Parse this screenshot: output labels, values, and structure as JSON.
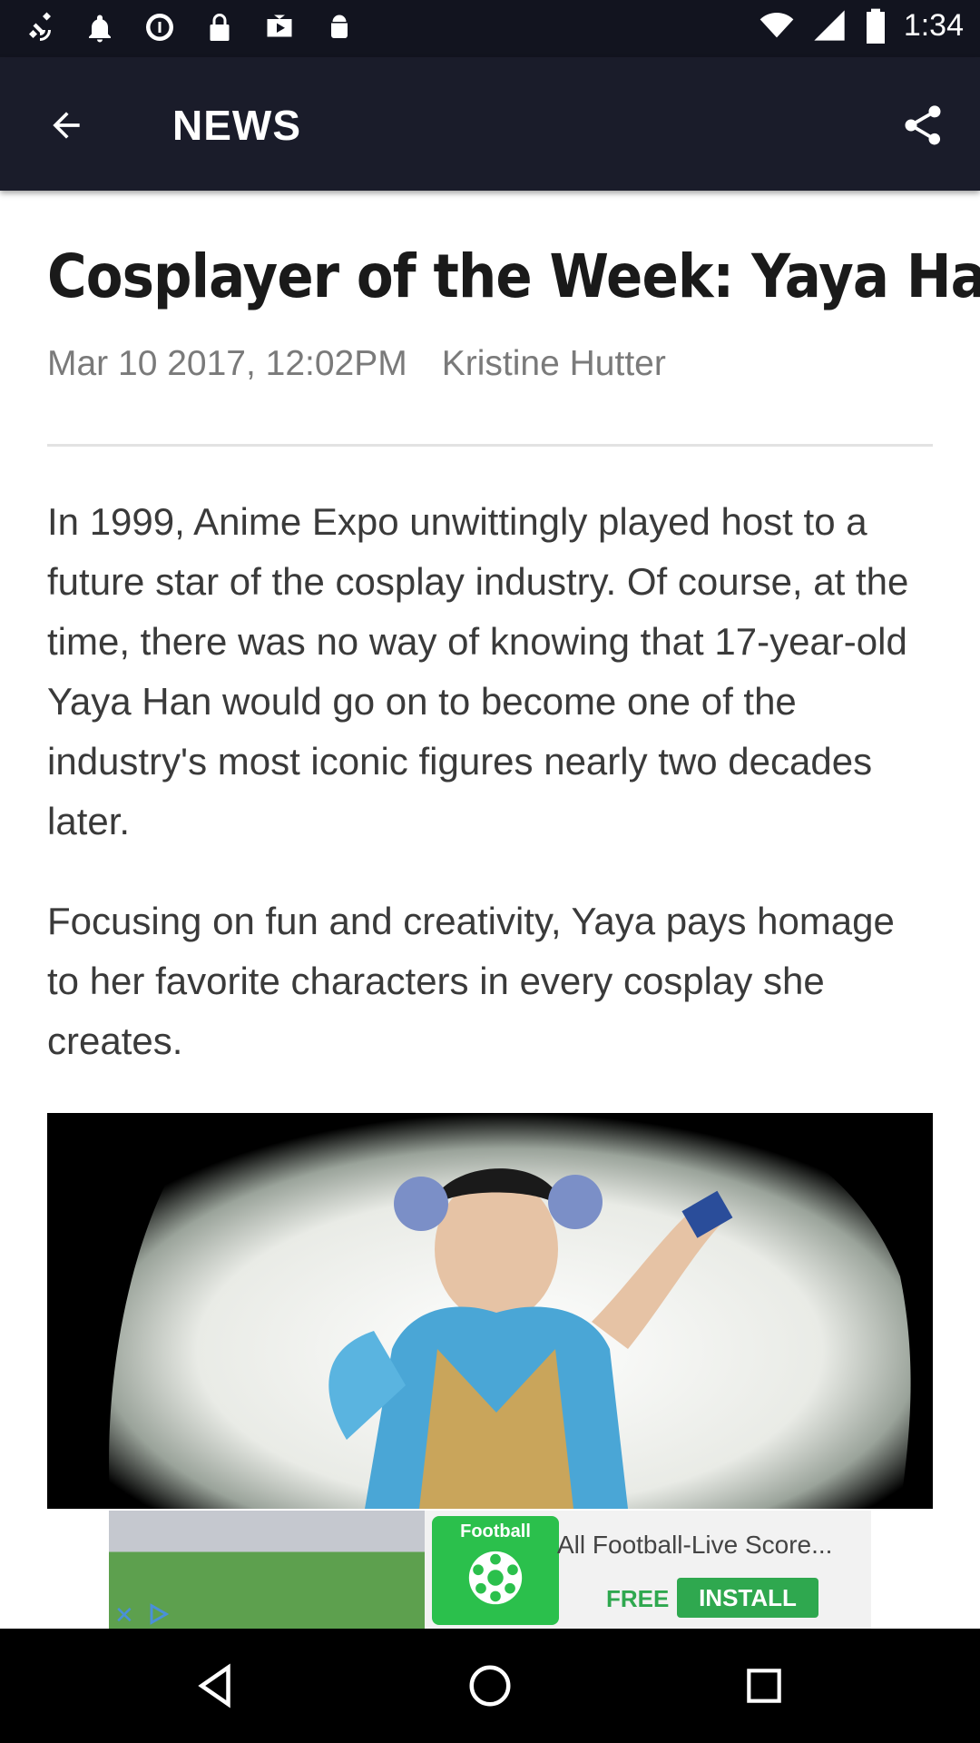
{
  "status_bar": {
    "time": "1:34",
    "icons": [
      "satellite-icon",
      "alarm-clock-icon",
      "data-saver-icon",
      "lock-icon",
      "youtube-icon",
      "android-icon"
    ],
    "right_icons": [
      "wifi-icon",
      "signal-icon",
      "battery-icon"
    ]
  },
  "app_bar": {
    "title": "NEWS",
    "back_icon": "arrow-left-icon",
    "share_icon": "share-icon"
  },
  "article": {
    "headline": "Cosplayer of the Week: Yaya Han",
    "date": "Mar 10 2017, 12:02PM",
    "author": "Kristine Hutter",
    "paragraphs": [
      "In 1999, Anime Expo unwittingly played host to a future star of the cosplay industry. Of course, at the time, there was no way of knowing that 17-year-old Yaya Han would go on to become one of the industry's most iconic figures nearly two decades later.",
      "Focusing on fun and creativity, Yaya pays homage to her favorite characters in every cosplay she creates."
    ]
  },
  "ad": {
    "title": "All Football-Live Score...",
    "badge": "Football",
    "free": "FREE",
    "install": "INSTALL"
  },
  "nav": {
    "back": "nav-back-icon",
    "home": "nav-home-icon",
    "recents": "nav-recents-icon"
  },
  "colors": {
    "app_bar": "#1a1c2a",
    "status_bar": "#12141f",
    "ad_green": "#2fa84f"
  }
}
